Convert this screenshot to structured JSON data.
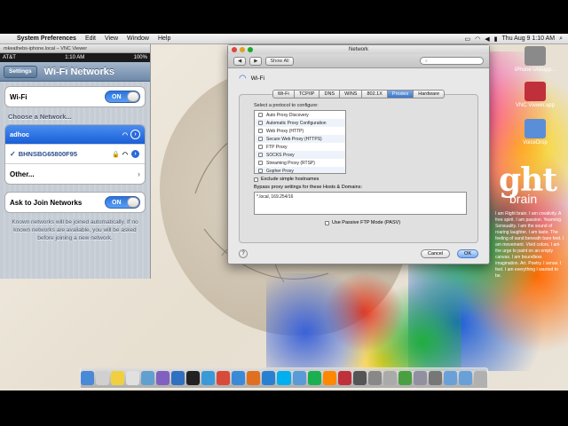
{
  "menubar": {
    "app_name": "System Preferences",
    "items": [
      "Edit",
      "View",
      "Window",
      "Help"
    ],
    "clock": "Thu Aug 9  1:10 AM"
  },
  "vnc": {
    "title": "mkeathebs-iphone.local – VNC Viewer",
    "ios_status": {
      "carrier": "AT&T",
      "time": "1:10 AM",
      "battery": "100%"
    },
    "back_label": "Settings",
    "nav_title": "Wi-Fi Networks",
    "wifi_label": "Wi-Fi",
    "wifi_toggle": "ON",
    "choose_label": "Choose a Network...",
    "networks": [
      {
        "name": "adhoc",
        "selected": true
      },
      {
        "name": "BHNSBG65800F95",
        "checked": true
      }
    ],
    "other_label": "Other...",
    "ask_label": "Ask to Join Networks",
    "ask_toggle": "ON",
    "footer_note": "Known networks will be joined automatically. If no known networks are available, you will be asked before joining a new network."
  },
  "network_window": {
    "title": "Network",
    "show_all": "Show All",
    "interface": "Wi-Fi",
    "tabs": [
      "Wi-Fi",
      "TCP/IP",
      "DNS",
      "WINS",
      "802.1X",
      "Proxies",
      "Hardware"
    ],
    "active_tab": "Proxies",
    "select_label": "Select a protocol to configure:",
    "protocols": [
      "Auto Proxy Discovery",
      "Automatic Proxy Configuration",
      "Web Proxy (HTTP)",
      "Secure Web Proxy (HTTPS)",
      "FTP Proxy",
      "SOCKS Proxy",
      "Streaming Proxy (RTSP)",
      "Gopher Proxy"
    ],
    "exclude_label": "Exclude simple hostnames",
    "bypass_label": "Bypass proxy settings for these Hosts & Domains:",
    "bypass_value": "*.local, 169.254/16",
    "passive_label": "Use Passive FTP Mode (PASV)",
    "help": "?",
    "cancel": "Cancel",
    "ok": "OK"
  },
  "desktop": {
    "icons": [
      {
        "label": "iPhone Unsupp...",
        "color": "#8a8a8a"
      },
      {
        "label": "VNC Viewer.app",
        "color": "#c0303a"
      },
      {
        "label": "VoiceDrop",
        "color": "#5a8ed8"
      }
    ],
    "wallpaper_big": "ght",
    "wallpaper_small": "brain",
    "wallpaper_copy": "I am Right brain. I am creativity. A free spirit. I am passion. Yearning. Sensuality. I am the sound of roaring laughter. I am taste. The feeling of sand beneath bare feet. I am movement. Vivid colors. I am the urge to paint on an empty canvas. I am boundless imagination. Art. Poetry. I sense. I feel. I am everything I wanted to be."
  },
  "dock": {
    "icons": [
      "finder-icon",
      "calendar-icon",
      "notes-icon",
      "textedit-icon",
      "preview-icon",
      "photos-icon",
      "xcode-icon",
      "terminal-icon",
      "itunes-icon",
      "chrome-icon",
      "safari-icon",
      "firefox-icon",
      "mail-icon",
      "skype-icon",
      "itunes2-icon",
      "spotify-icon",
      "vlc-icon",
      "vnc-icon",
      "pen-icon",
      "scripts-icon",
      "network-icon",
      "utorrent-icon",
      "vmware-icon",
      "sysprefs-icon",
      "folder-icon",
      "downloads-icon",
      "trash-icon"
    ],
    "colors": [
      "#4a88d8",
      "#d0d0d0",
      "#f0d040",
      "#e0e0e0",
      "#60a0d0",
      "#8060c0",
      "#3070c0",
      "#222222",
      "#3a9ad8",
      "#d84a3a",
      "#3a8ad8",
      "#e07020",
      "#2a80d0",
      "#00aff0",
      "#5a9ad8",
      "#1ab050",
      "#ff8800",
      "#c0303a",
      "#555555",
      "#888888",
      "#aaaaaa",
      "#4aa040",
      "#9090a0",
      "#777777",
      "#6aa0d8",
      "#6aa0d8",
      "#b0b0b0"
    ]
  }
}
